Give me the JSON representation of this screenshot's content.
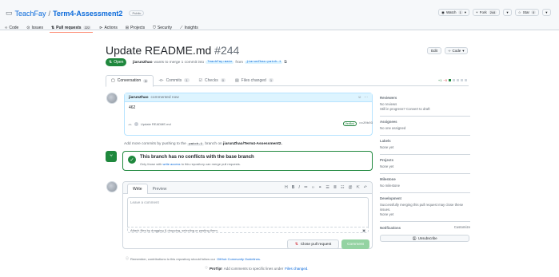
{
  "repo": {
    "owner": "TeachFay",
    "sep": "/",
    "name": "Term4-Assessment2",
    "visibility": "Public",
    "watch_label": "Watch",
    "watch_count": "1",
    "fork_label": "Fork",
    "fork_count": "244",
    "star_label": "Star",
    "star_count": "0"
  },
  "nav": {
    "code": "Code",
    "issues": "Issues",
    "pull_requests": "Pull requests",
    "pr_count": "222",
    "actions": "Actions",
    "projects": "Projects",
    "security": "Security",
    "insights": "Insights"
  },
  "pr": {
    "title": "Update README.md",
    "number": "#244",
    "status": "Open",
    "author": "jiarunZhao",
    "meta_text": "wants to merge 1 commit into",
    "base_branch": "TeachFay:main",
    "from_word": "from",
    "head_branch": "jiarunZhao:patch-1",
    "edit_label": "Edit",
    "code_label": "Code"
  },
  "tabs": {
    "conversation": "Conversation",
    "conversation_count": "0",
    "commits": "Commits",
    "commits_count": "1",
    "checks": "Checks",
    "checks_count": "0",
    "files": "Files changed",
    "files_count": "1",
    "additions": "+1",
    "deletions": "−0"
  },
  "comment": {
    "author": "jiarunZhao",
    "action": "commented now",
    "body": "462"
  },
  "commit": {
    "message": "Update README.md",
    "verified": "Verified",
    "sha": "cc20b03"
  },
  "push_hint": {
    "prefix": "Add more commits by pushing to the",
    "branch": "patch-1",
    "middle": "branch on",
    "repo": "jiarunZhao/Term4-Assessment2."
  },
  "merge": {
    "title": "This branch has no conflicts with the base branch",
    "sub_prefix": "Only those with",
    "sub_link": "write access",
    "sub_suffix": "to this repository can merge pull requests."
  },
  "editor": {
    "write_tab": "Write",
    "preview_tab": "Preview",
    "placeholder": "Leave a comment",
    "attach_text": "Attach files by dragging & dropping, selecting or pasting them.",
    "close_label": "Close pull request",
    "comment_label": "Comment"
  },
  "footer": {
    "reminder_prefix": "Remember, contributions to this repository should follow our",
    "reminder_link": "GitHub Community Guidelines.",
    "protip_label": "ProTip!",
    "protip_text": "Add comments to specific lines under",
    "protip_link": "Files changed."
  },
  "sidebar": {
    "reviewers_h": "Reviewers",
    "reviewers_t": "No reviews",
    "reviewers_t2": "Still in progress?",
    "reviewers_link": "Convert to draft",
    "assignees_h": "Assignees",
    "assignees_t": "No one assigned",
    "labels_h": "Labels",
    "labels_t": "None yet",
    "projects_h": "Projects",
    "projects_t": "None yet",
    "milestone_h": "Milestone",
    "milestone_t": "No milestone",
    "development_h": "Development",
    "development_t": "Successfully merging this pull request may close these issues.",
    "development_t2": "None yet",
    "notifications_h": "Notifications",
    "customize": "Customize",
    "unsubscribe": "Unsubscribe"
  },
  "colors": {
    "accent": "#0969da",
    "open_green": "#1f883d",
    "tab_underline": "#fd8c73"
  }
}
